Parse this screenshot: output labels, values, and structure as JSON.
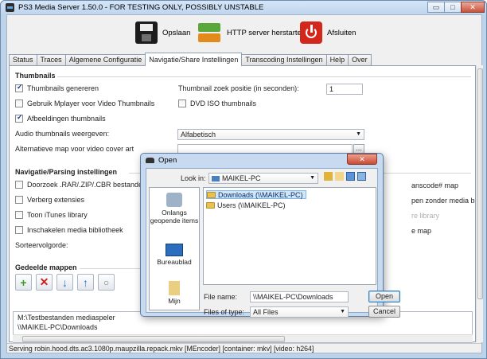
{
  "window": {
    "title": "PS3 Media Server 1.50.0 - FOR TESTING ONLY, POSSIBLY UNSTABLE",
    "controls": {
      "minimize": "▭",
      "maximize": "□",
      "close": "✕"
    }
  },
  "toolbar": {
    "save": "Opslaan",
    "restart": "HTTP server herstarten",
    "quit": "Afsluiten"
  },
  "tabs": [
    "Status",
    "Traces",
    "Algemene Configuratie",
    "Navigatie/Share Instellingen",
    "Transcoding Instellingen",
    "Help",
    "Over"
  ],
  "thumbnails": {
    "section": "Thumbnails",
    "generate": "Thumbnails genereren",
    "mplayer": "Gebruik Mplayer voor Video Thumbnails",
    "images": "Afbeeldingen thumbnails",
    "seek_label": "Thumbnail zoek positie (in seconden):",
    "seek_value": "1",
    "dvd_iso": "DVD ISO thumbnails",
    "audio_label": "Audio thumbnails weergeven:",
    "audio_value": "Alfabetisch",
    "alt_folder_label": "Alternatieve map voor video cover art",
    "alt_folder_btn": "..."
  },
  "navigation": {
    "section": "Navigatie/Parsing instellingen",
    "browse_rar": "Doorzoek .RAR/.ZIP/.CBR bestanden",
    "hide_ext": "Verberg extensies",
    "itunes": "Toon iTunes library",
    "media_lib": "Inschakelen media bibliotheek",
    "sort_label": "Sorteervolgorde:",
    "right_1": "anscode# map",
    "right_2": "pen zonder media b",
    "right_3": "re library",
    "right_4": "e map"
  },
  "shared": {
    "section": "Gedeelde mappen",
    "paths": [
      "M:\\Testbestanden mediaspeler",
      "\\\\MAIKEL-PC\\Downloads"
    ]
  },
  "status": "Serving robin.hood.dts.ac3.1080p.maupzilla.repack.mkv [MEncoder] [container: mkv] [video: h264]",
  "dialog": {
    "title": "Open",
    "close": "✕",
    "look_in_label": "Look in:",
    "look_in_value": "MAIKEL-PC",
    "places": [
      "Onlangs geopende items",
      "Bureaublad",
      "Mijn"
    ],
    "files": [
      "Downloads (\\\\MAIKEL-PC)",
      "Users (\\\\MAIKEL-PC)"
    ],
    "file_name_label": "File name:",
    "file_name_value": "\\\\MAIKEL-PC\\Downloads",
    "file_type_label": "Files of type:",
    "file_type_value": "All Files",
    "open": "Open",
    "cancel": "Cancel"
  }
}
